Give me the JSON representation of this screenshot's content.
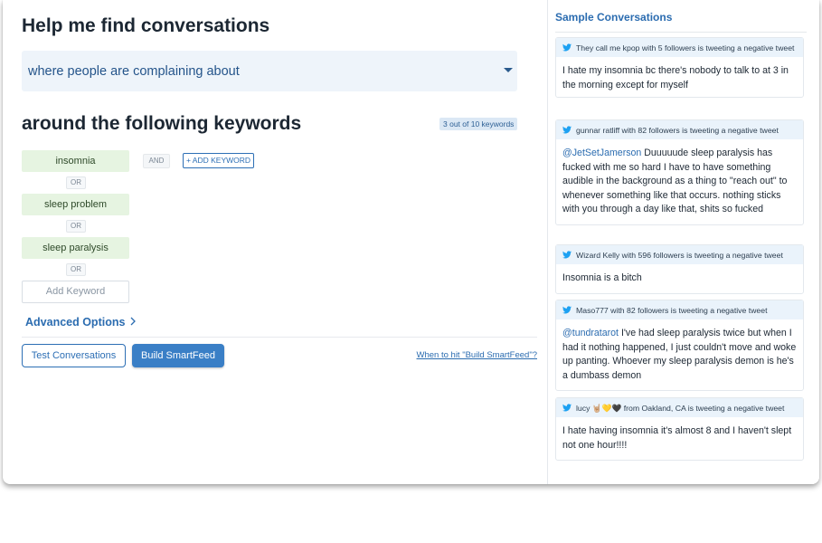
{
  "left": {
    "heading": "Help me find conversations",
    "dropdown": {
      "selected": "where people are complaining about"
    },
    "keywords_heading": "around the following keywords",
    "count_badge": "3 out of 10 keywords",
    "keywords": [
      "insomnia",
      "sleep problem",
      "sleep paralysis"
    ],
    "or_label": "OR",
    "and_label": "AND",
    "add_keyword_button": "+ ADD KEYWORD",
    "add_keyword_placeholder": "Add Keyword",
    "advanced_options": "Advanced Options",
    "test_button": "Test Conversations",
    "build_button": "Build SmartFeed",
    "when_link": "When to hit \"Build SmartFeed\"?"
  },
  "right": {
    "title": "Sample Conversations",
    "conversations": [
      {
        "header": "They call me kpop with 5 followers is tweeting a negative tweet",
        "mention": "",
        "text": "I hate my insomnia bc there's nobody to talk to at 3 in the morning except for myself"
      },
      {
        "header": "gunnar ratliff with 82 followers is tweeting a negative tweet",
        "mention": "@JetSetJamerson",
        "text": " Duuuuude sleep paralysis has fucked with me so hard I have to have something audible in the background as a thing to \"reach out\" to whenever something like that occurs. nothing sticks with you through a day like that, shits so fucked"
      },
      {
        "header": "Wizard Kelly with 596 followers is tweeting a negative tweet",
        "mention": "",
        "text": "Insomnia is a bitch"
      },
      {
        "header": "Maso777 with 82 followers is tweeting a negative tweet",
        "mention": "@tundratarot",
        "text": " I've had sleep paralysis twice but when I had it nothing happened, I just couldn't move and woke up panting. Whoever my sleep paralysis demon is he's a dumbass demon"
      },
      {
        "header": "lucy 🤘🏼💛🖤 from Oakland, CA is tweeting a negative tweet",
        "mention": "",
        "text": "I hate having insomnia it's almost 8 and I haven't slept not one hour!!!!"
      }
    ]
  },
  "colors": {
    "accent": "#2b6cb0",
    "keyword_bg": "#e6f4e1",
    "dropdown_bg": "#eef4fa",
    "card_head_bg": "#eaf3fb",
    "twitter_blue": "#1da1f2"
  },
  "icons": {
    "dropdown": "caret-down-icon",
    "advanced": "chevron-right-icon",
    "tweet": "twitter-bird-icon"
  }
}
